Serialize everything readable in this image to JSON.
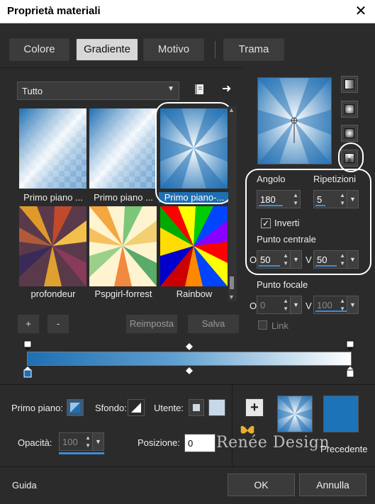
{
  "window": {
    "title": "Proprietà materiali",
    "close": "✕"
  },
  "tabs": [
    {
      "label": "Colore",
      "active": false
    },
    {
      "label": "Gradiente",
      "active": true
    },
    {
      "label": "Motivo",
      "active": false
    },
    {
      "label": "Trama",
      "active": false
    }
  ],
  "library": {
    "category": "Tutto",
    "thumbnails": [
      {
        "label": "Primo piano ...",
        "selected": false
      },
      {
        "label": "Primo piano ...",
        "selected": false
      },
      {
        "label": "Primo piano-...",
        "selected": true
      },
      {
        "label": "profondeur",
        "selected": false
      },
      {
        "label": "Pspgirl-forrest",
        "selected": false
      },
      {
        "label": "Rainbow",
        "selected": false
      }
    ],
    "buttons": {
      "add": "+",
      "remove": "-",
      "reset": "Reimposta",
      "save": "Salva"
    }
  },
  "gradient_settings": {
    "angle_label": "Angolo",
    "angle_value": "180",
    "repetitions_label": "Ripetizioni",
    "repetitions_value": "5",
    "invert_label": "Inverti",
    "invert_checked": true,
    "center_label": "Punto centrale",
    "center_o_label": "O",
    "center_o_value": "50",
    "center_v_label": "V",
    "center_v_value": "50",
    "focal_label": "Punto focale",
    "focal_o_label": "O",
    "focal_o_value": "0",
    "focal_v_label": "V",
    "focal_v_value": "100",
    "link_label": "Link",
    "link_checked": false
  },
  "bottom": {
    "foreground_label": "Primo piano:",
    "background_label": "Sfondo:",
    "user_label": "Utente:",
    "opacity_label": "Opacità:",
    "opacity_value": "100",
    "position_label": "Posizione:",
    "position_value": "0",
    "previous_label": "Precedente",
    "add_symbol": "+"
  },
  "watermark": "Renée Design",
  "footer": {
    "help": "Guida",
    "ok": "OK",
    "cancel": "Annulla"
  },
  "colors": {
    "accent_blue": "#1f6fb3",
    "dark_bg": "#2b2b2b",
    "previous_swatch": "#1c73b7"
  },
  "icons": {
    "book": "book-icon",
    "arrow": "arrow-right-icon",
    "close": "close-icon"
  }
}
